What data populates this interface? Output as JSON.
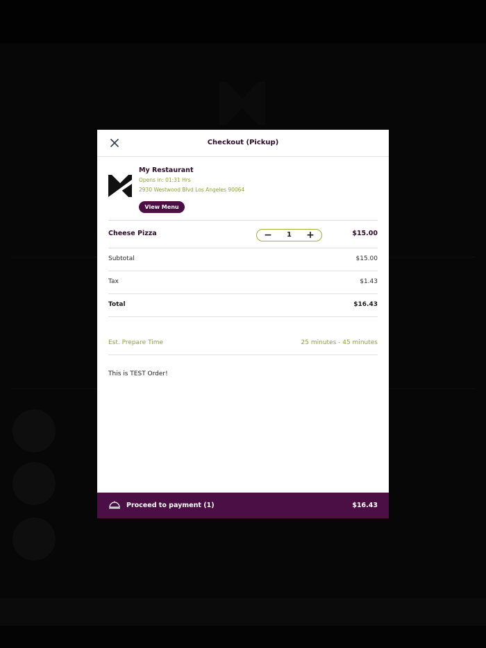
{
  "modal": {
    "title": "Checkout (Pickup)",
    "close_icon": "close-icon"
  },
  "restaurant": {
    "name": "My Restaurant",
    "opens": "Opens in: 01:31 Hrs",
    "address": "2930 Westwood Blvd Los Angeles 90064",
    "view_menu_label": "View Menu",
    "logo_icon": "restaurant-logo-icon"
  },
  "cart": {
    "items": [
      {
        "name": "Cheese Pizza",
        "quantity": "1",
        "price": "$15.00"
      }
    ]
  },
  "summary": {
    "subtotal_label": "Subtotal",
    "subtotal_value": "$15.00",
    "tax_label": "Tax",
    "tax_value": "$1.43",
    "total_label": "Total",
    "total_value": "$16.43"
  },
  "prepare": {
    "label": "Est. Prepare Time",
    "value": "25 minutes - 45 minutes"
  },
  "note": "This is TEST Order!",
  "payment": {
    "label": "Proceed to payment (1)",
    "total": "$16.43",
    "icon": "cloche-icon"
  },
  "colors": {
    "brand_purple": "#4c0f45",
    "accent_green": "#8aa82b",
    "overlay": "#050505"
  }
}
